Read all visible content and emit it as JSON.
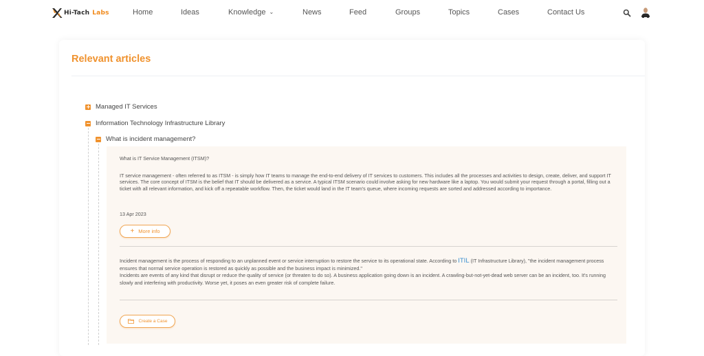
{
  "nav": {
    "logo": {
      "primary": "Hi-Tach",
      "secondary": "Labs"
    },
    "items": [
      {
        "label": "Home"
      },
      {
        "label": "Ideas"
      },
      {
        "label": "Knowledge",
        "has_dropdown": true
      },
      {
        "label": "News"
      },
      {
        "label": "Feed"
      },
      {
        "label": "Groups"
      },
      {
        "label": "Topics"
      },
      {
        "label": "Cases"
      },
      {
        "label": "Contact Us"
      }
    ],
    "dropdown_glyph": "⌄",
    "search_icon": "search-icon",
    "avatar_icon": "user-avatar"
  },
  "colors": {
    "accent": "#f0922e",
    "link": "#3a8fd0",
    "panel_bg": "#fcf7f2"
  },
  "card": {
    "title": "Relevant articles",
    "tree": [
      {
        "label": "Managed IT Services",
        "state": "collapsed"
      },
      {
        "label": "Information Technology Infrastructure Library",
        "state": "expanded"
      },
      {
        "label": "What is incident management?",
        "state": "expanded"
      }
    ],
    "article": {
      "question": "What is IT Service Management (ITSM)?",
      "body": "IT service management - often referred to as ITSM - is simply how IT teams to manage the end-to-end delivery of IT services to customers. This includes all the processes and activities to design, create, deliver, and support IT services. The core concept of ITSM is the belief that IT should be delivered as a service. A typical ITSM scenario could involve asking for new hardware like a laptop. You would submit your request through a portal, filling out a ticket with all relevant information, and kick off a repeatable workflow. Then, the ticket would land in the IT team's queue, where incoming requests are sorted and addressed according to importance.",
      "date": "13 Apr 2023",
      "more_info_label": "More info",
      "incident_part1": "Incident management is the process of responding to an unplanned event or service interruption to restore the service to its operational state. According to ",
      "itil_link": "ITIL",
      "incident_part2": " (IT Infrastructure Library), \"the incident management process ensures that normal service operation is restored as quickly as possible and the business impact is minimized.\"",
      "incident_part3": "Incidents are events of any kind that disrupt or reduce the quality of service (or threaten to do so). A business application going down is an incident. A crawling-but-not-yet-dead web server can be an incident, too. It's running slowly and interfering with productivity. Worse yet, it poses an even greater risk of complete failure.",
      "create_case_label": "Create a Case"
    }
  }
}
